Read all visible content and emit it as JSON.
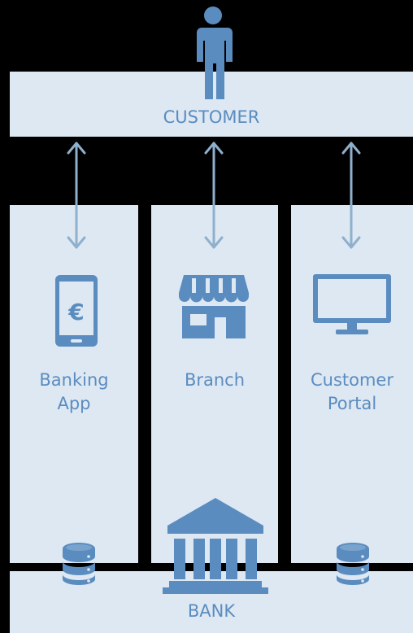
{
  "customer": {
    "label": "CUSTOMER"
  },
  "bank": {
    "label": "BANK"
  },
  "channels": [
    {
      "label": "Banking\nApp",
      "icon": "smartphone-euro-icon",
      "symbol": "€"
    },
    {
      "label": "Branch",
      "icon": "storefront-icon"
    },
    {
      "label": "Customer\nPortal",
      "icon": "monitor-icon"
    }
  ],
  "colors": {
    "background": "#000000",
    "panel": "#dde8f2",
    "icon": "#5b8cc0",
    "arrow": "#8fb0cd"
  },
  "icons": [
    "person-icon",
    "bank-building-icon",
    "database-icon"
  ]
}
